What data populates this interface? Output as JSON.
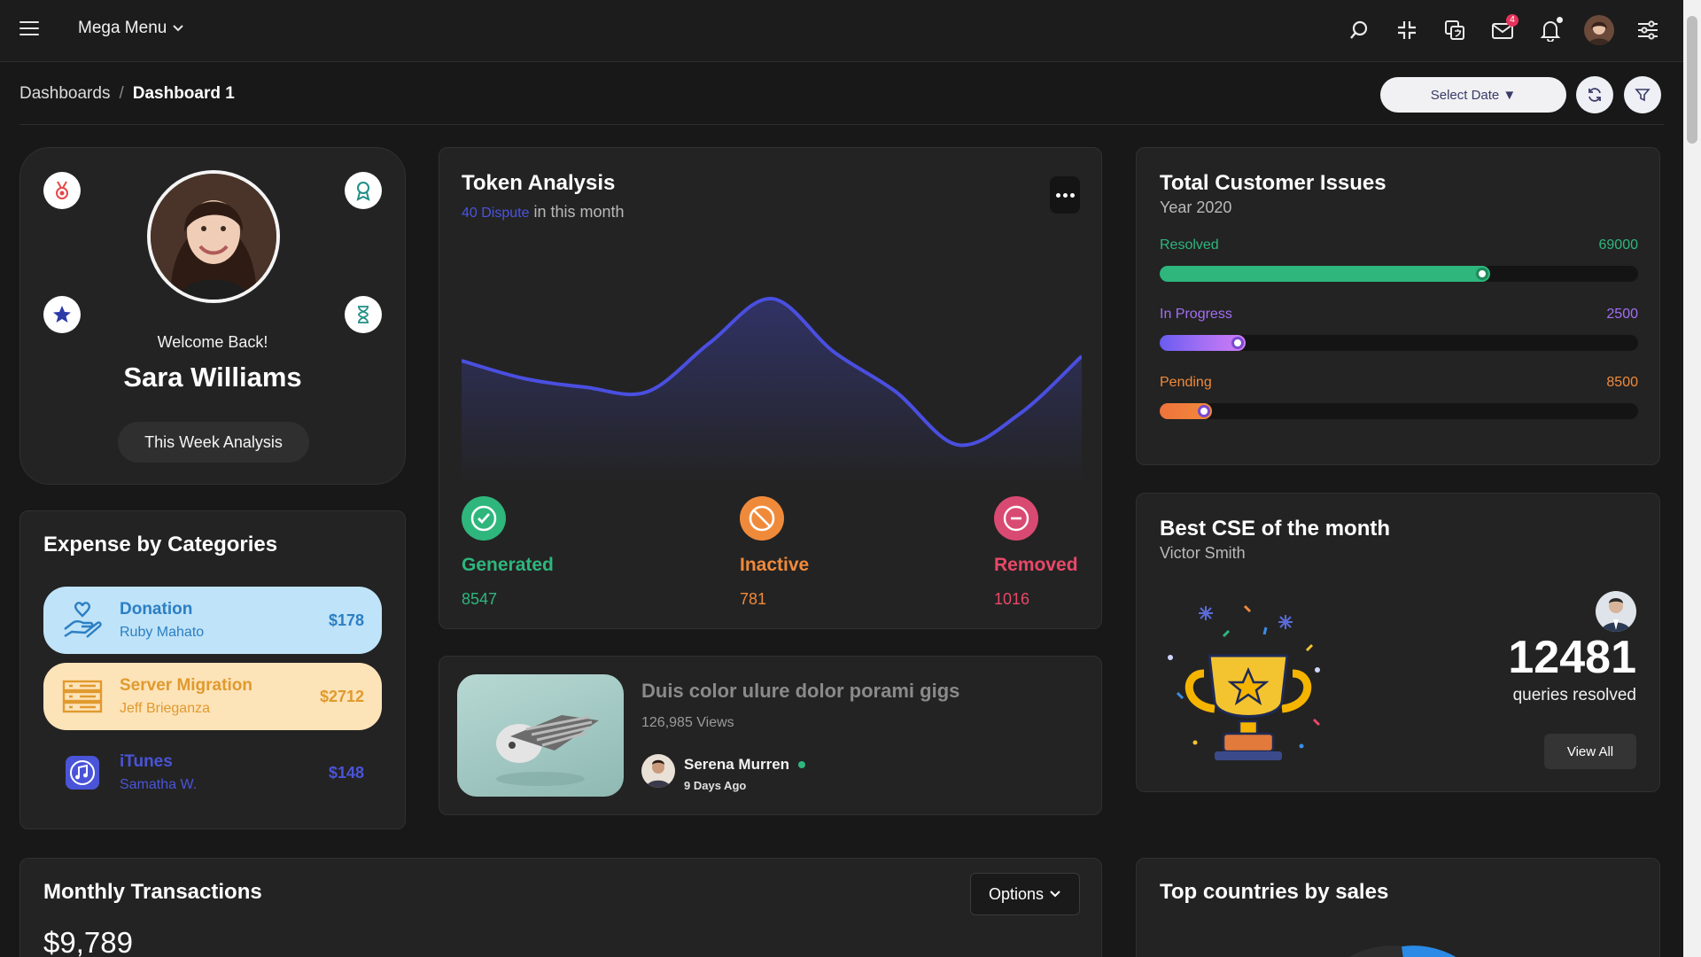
{
  "topbar": {
    "mega_menu": "Mega Menu",
    "mail_badge": "4"
  },
  "breadcrumb": {
    "root": "Dashboards",
    "separator": "/",
    "current": "Dashboard 1"
  },
  "toolbar": {
    "select_date": "Select Date ▼"
  },
  "profile": {
    "welcome": "Welcome Back!",
    "name": "Sara Williams",
    "button": "This Week Analysis"
  },
  "expense": {
    "title": "Expense by Categories",
    "items": [
      {
        "title": "Donation",
        "person": "Ruby Mahato",
        "amount": "$178",
        "bg": "#bfe3f8",
        "fg": "#2b7fc4"
      },
      {
        "title": "Server Migration",
        "person": "Jeff Brieganza",
        "amount": "$2712",
        "bg": "#fde3b8",
        "fg": "#e09a2e"
      },
      {
        "title": "iTunes",
        "person": "Samatha W.",
        "amount": "$148",
        "bg": "transparent",
        "fg": "#4a54d8"
      }
    ]
  },
  "token": {
    "title": "Token Analysis",
    "dispute": "40 Dispute",
    "suffix": "in this month",
    "stats": [
      {
        "label": "Generated",
        "value": "8547",
        "color": "#2eb67d"
      },
      {
        "label": "Inactive",
        "value": "781",
        "color": "#f08a3b"
      },
      {
        "label": "Removed",
        "value": "1016",
        "color": "#e94868"
      }
    ]
  },
  "video": {
    "title": "Duis color ulure dolor porami gigs",
    "views": "126,985 Views",
    "author": "Serena Murren",
    "age": "9 Days Ago"
  },
  "issues": {
    "title": "Total Customer Issues",
    "subtitle": "Year 2020",
    "rows": [
      {
        "label": "Resolved",
        "value": "69000",
        "fraction": 0.69,
        "color": "#2eb67d"
      },
      {
        "label": "In Progress",
        "value": "2500",
        "fraction": 0.18,
        "color": "#a36ff4"
      },
      {
        "label": "Pending",
        "value": "8500",
        "fraction": 0.11,
        "color": "#f08a3b"
      }
    ]
  },
  "cse": {
    "title": "Best CSE of the month",
    "name": "Victor Smith",
    "count": "12481",
    "label": "queries resolved",
    "button": "View All"
  },
  "monthly": {
    "title": "Monthly Transactions",
    "amount": "$9,789",
    "options": "Options"
  },
  "countries": {
    "title": "Top countries by sales"
  },
  "chart_data": {
    "type": "area",
    "x": [
      0,
      1,
      2,
      3,
      4,
      5,
      6,
      7,
      8,
      9,
      10
    ],
    "values": [
      52,
      44,
      40,
      38,
      60,
      80,
      56,
      38,
      14,
      28,
      54
    ],
    "ylim": [
      0,
      100
    ],
    "color": "#4a4fe0"
  }
}
